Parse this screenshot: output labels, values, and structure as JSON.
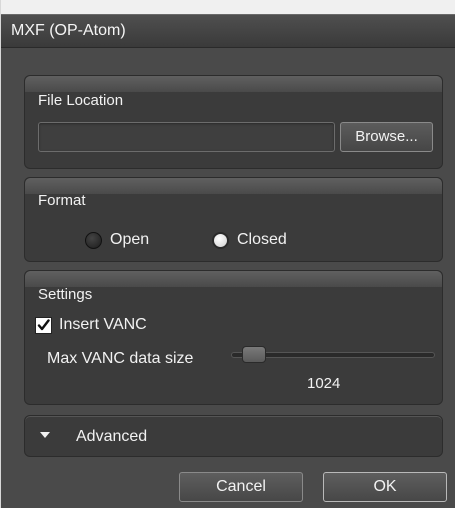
{
  "window": {
    "title": "MXF (OP-Atom)"
  },
  "file_location": {
    "title": "File Location",
    "path_value": "",
    "browse_label": "Browse..."
  },
  "format": {
    "title": "Format",
    "options": [
      {
        "label": "Open",
        "selected": false
      },
      {
        "label": "Closed",
        "selected": true
      }
    ]
  },
  "settings": {
    "title": "Settings",
    "insert_vanc": {
      "label": "Insert VANC",
      "checked": true
    },
    "max_vanc": {
      "label": "Max VANC data size",
      "value": "1024",
      "slider_level": 0.06
    }
  },
  "advanced": {
    "label": "Advanced",
    "expanded": false,
    "icon": "chevron-down-icon"
  },
  "footer": {
    "cancel_label": "Cancel",
    "ok_label": "OK"
  },
  "colors": {
    "dialog_bg": "#4a4a4a",
    "panel_bg": "#3b3b3b",
    "text": "#f2f2f2"
  }
}
